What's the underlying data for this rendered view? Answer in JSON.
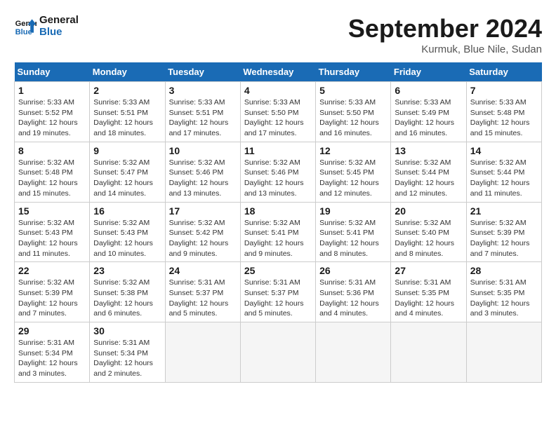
{
  "header": {
    "logo_line1": "General",
    "logo_line2": "Blue",
    "month": "September 2024",
    "location": "Kurmuk, Blue Nile, Sudan"
  },
  "days_of_week": [
    "Sunday",
    "Monday",
    "Tuesday",
    "Wednesday",
    "Thursday",
    "Friday",
    "Saturday"
  ],
  "weeks": [
    [
      {
        "num": "1",
        "info": "Sunrise: 5:33 AM\nSunset: 5:52 PM\nDaylight: 12 hours\nand 19 minutes."
      },
      {
        "num": "2",
        "info": "Sunrise: 5:33 AM\nSunset: 5:51 PM\nDaylight: 12 hours\nand 18 minutes."
      },
      {
        "num": "3",
        "info": "Sunrise: 5:33 AM\nSunset: 5:51 PM\nDaylight: 12 hours\nand 17 minutes."
      },
      {
        "num": "4",
        "info": "Sunrise: 5:33 AM\nSunset: 5:50 PM\nDaylight: 12 hours\nand 17 minutes."
      },
      {
        "num": "5",
        "info": "Sunrise: 5:33 AM\nSunset: 5:50 PM\nDaylight: 12 hours\nand 16 minutes."
      },
      {
        "num": "6",
        "info": "Sunrise: 5:33 AM\nSunset: 5:49 PM\nDaylight: 12 hours\nand 16 minutes."
      },
      {
        "num": "7",
        "info": "Sunrise: 5:33 AM\nSunset: 5:48 PM\nDaylight: 12 hours\nand 15 minutes."
      }
    ],
    [
      {
        "num": "8",
        "info": "Sunrise: 5:32 AM\nSunset: 5:48 PM\nDaylight: 12 hours\nand 15 minutes."
      },
      {
        "num": "9",
        "info": "Sunrise: 5:32 AM\nSunset: 5:47 PM\nDaylight: 12 hours\nand 14 minutes."
      },
      {
        "num": "10",
        "info": "Sunrise: 5:32 AM\nSunset: 5:46 PM\nDaylight: 12 hours\nand 13 minutes."
      },
      {
        "num": "11",
        "info": "Sunrise: 5:32 AM\nSunset: 5:46 PM\nDaylight: 12 hours\nand 13 minutes."
      },
      {
        "num": "12",
        "info": "Sunrise: 5:32 AM\nSunset: 5:45 PM\nDaylight: 12 hours\nand 12 minutes."
      },
      {
        "num": "13",
        "info": "Sunrise: 5:32 AM\nSunset: 5:44 PM\nDaylight: 12 hours\nand 12 minutes."
      },
      {
        "num": "14",
        "info": "Sunrise: 5:32 AM\nSunset: 5:44 PM\nDaylight: 12 hours\nand 11 minutes."
      }
    ],
    [
      {
        "num": "15",
        "info": "Sunrise: 5:32 AM\nSunset: 5:43 PM\nDaylight: 12 hours\nand 11 minutes."
      },
      {
        "num": "16",
        "info": "Sunrise: 5:32 AM\nSunset: 5:43 PM\nDaylight: 12 hours\nand 10 minutes."
      },
      {
        "num": "17",
        "info": "Sunrise: 5:32 AM\nSunset: 5:42 PM\nDaylight: 12 hours\nand 9 minutes."
      },
      {
        "num": "18",
        "info": "Sunrise: 5:32 AM\nSunset: 5:41 PM\nDaylight: 12 hours\nand 9 minutes."
      },
      {
        "num": "19",
        "info": "Sunrise: 5:32 AM\nSunset: 5:41 PM\nDaylight: 12 hours\nand 8 minutes."
      },
      {
        "num": "20",
        "info": "Sunrise: 5:32 AM\nSunset: 5:40 PM\nDaylight: 12 hours\nand 8 minutes."
      },
      {
        "num": "21",
        "info": "Sunrise: 5:32 AM\nSunset: 5:39 PM\nDaylight: 12 hours\nand 7 minutes."
      }
    ],
    [
      {
        "num": "22",
        "info": "Sunrise: 5:32 AM\nSunset: 5:39 PM\nDaylight: 12 hours\nand 7 minutes."
      },
      {
        "num": "23",
        "info": "Sunrise: 5:32 AM\nSunset: 5:38 PM\nDaylight: 12 hours\nand 6 minutes."
      },
      {
        "num": "24",
        "info": "Sunrise: 5:31 AM\nSunset: 5:37 PM\nDaylight: 12 hours\nand 5 minutes."
      },
      {
        "num": "25",
        "info": "Sunrise: 5:31 AM\nSunset: 5:37 PM\nDaylight: 12 hours\nand 5 minutes."
      },
      {
        "num": "26",
        "info": "Sunrise: 5:31 AM\nSunset: 5:36 PM\nDaylight: 12 hours\nand 4 minutes."
      },
      {
        "num": "27",
        "info": "Sunrise: 5:31 AM\nSunset: 5:35 PM\nDaylight: 12 hours\nand 4 minutes."
      },
      {
        "num": "28",
        "info": "Sunrise: 5:31 AM\nSunset: 5:35 PM\nDaylight: 12 hours\nand 3 minutes."
      }
    ],
    [
      {
        "num": "29",
        "info": "Sunrise: 5:31 AM\nSunset: 5:34 PM\nDaylight: 12 hours\nand 3 minutes."
      },
      {
        "num": "30",
        "info": "Sunrise: 5:31 AM\nSunset: 5:34 PM\nDaylight: 12 hours\nand 2 minutes."
      },
      {
        "num": "",
        "info": ""
      },
      {
        "num": "",
        "info": ""
      },
      {
        "num": "",
        "info": ""
      },
      {
        "num": "",
        "info": ""
      },
      {
        "num": "",
        "info": ""
      }
    ]
  ]
}
